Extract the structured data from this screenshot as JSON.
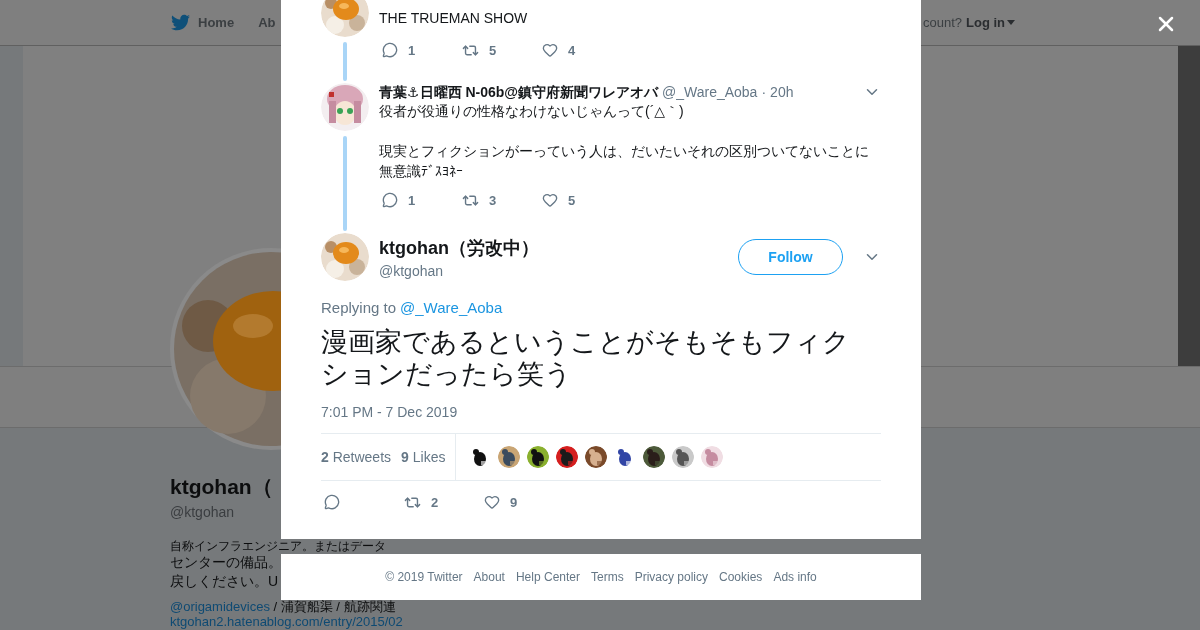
{
  "background_page": {
    "nav": {
      "items": [
        "Home",
        "Ab"
      ],
      "account_prompt": "count?",
      "login": "Log in"
    },
    "profile": {
      "avatar": {
        "kind": "picture"
      },
      "name": "ktgohan（",
      "handle": "@ktgohan",
      "bio_lines": [
        [
          {
            "kind": "text",
            "text": "自称インフラエンジニア。またはデータ"
          }
        ],
        [
          {
            "kind": "text",
            "text": "センターの備品。"
          }
        ],
        [
          {
            "kind": "text",
            "text": "戻しください。U"
          }
        ],
        [
          {
            "kind": "link",
            "text": "@origamidevices"
          },
          {
            "kind": "text",
            "text": " / 浦賀船渠 / 航跡関連"
          }
        ],
        [
          {
            "kind": "link",
            "text": "ktgohan2.hatenablog.com/entry/2015/02"
          }
        ]
      ]
    }
  },
  "modal": {
    "thread": [
      {
        "avatar": {
          "kind": "picture"
        },
        "text": "THE TRUEMAN SHOW",
        "replies": "1",
        "retweets": "5",
        "likes": "4"
      },
      {
        "avatar": {
          "kind": "picture"
        },
        "name": "青葉⚓日曜西 N-06b@鎮守府新聞ワレアオバ",
        "handle": "@_Ware_Aoba",
        "separator": "·",
        "time": "20h",
        "text": "役者が役通りの性格なわけないじゃんって(´△｀)\n\n現実とフィクションがーっていう人は、だいたいそれの区別ついてないことに無意識ﾃﾞｽﾖﾈｰ",
        "replies": "1",
        "retweets": "3",
        "likes": "5"
      }
    ],
    "main_tweet": {
      "avatar": {
        "kind": "picture"
      },
      "name": "ktgohan（労改中）",
      "handle": "@ktgohan",
      "follow": "Follow",
      "replying_label": "Replying to",
      "replying_to": "@_Ware_Aoba",
      "text": "漫画家であるということがそもそもフィクションだったら笑う",
      "time": "7:01 PM - 7 Dec 2019",
      "retweet_stat": "**2** Retweets",
      "like_stat": "**9** Likes",
      "liker_avatars": [
        {
          "kind": "picture"
        },
        {
          "kind": "picture"
        },
        {
          "kind": "picture"
        },
        {
          "kind": "picture"
        },
        {
          "kind": "picture"
        },
        {
          "kind": "picture"
        },
        {
          "kind": "picture"
        },
        {
          "kind": "picture"
        },
        {
          "kind": "picture"
        }
      ],
      "retweets": "2",
      "likes": "9"
    }
  },
  "footer": [
    "© 2019 Twitter",
    "About",
    "Help Center",
    "Terms",
    "Privacy policy",
    "Cookies",
    "Ads info"
  ]
}
